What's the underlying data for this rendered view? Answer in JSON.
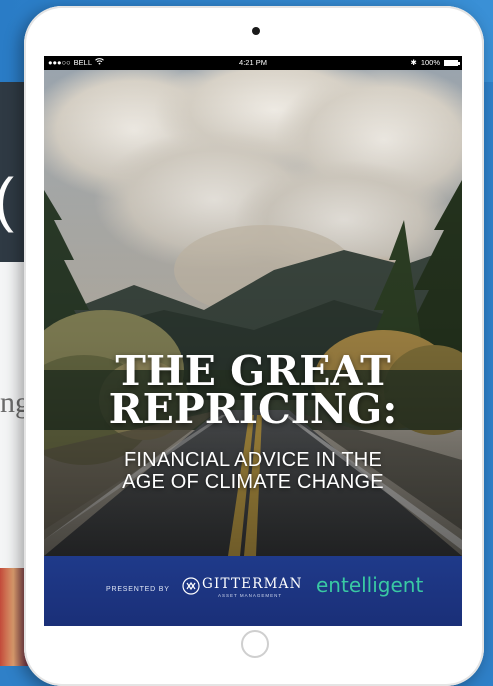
{
  "background_page": {
    "dark_panel_glyph": "(",
    "light_panel_text": "ng"
  },
  "status_bar": {
    "carrier": "BELL",
    "time": "4:21 PM",
    "battery": "100%"
  },
  "cover": {
    "title_line1": "THE GREAT",
    "title_line2": "REPRICING:",
    "subtitle_line1": "FINANCIAL ADVICE IN THE",
    "subtitle_line2": "AGE OF CLIMATE CHANGE"
  },
  "footer": {
    "presented_by": "PRESENTED BY",
    "sponsor1_name": "GITTERMAN",
    "sponsor1_sub": "ASSET MANAGEMENT",
    "sponsor2_name": "entelligent"
  },
  "colors": {
    "page_blue": "#2f80c8",
    "footer_blue": "#1f3a8a",
    "entelligent_green": "#39c9a3"
  }
}
